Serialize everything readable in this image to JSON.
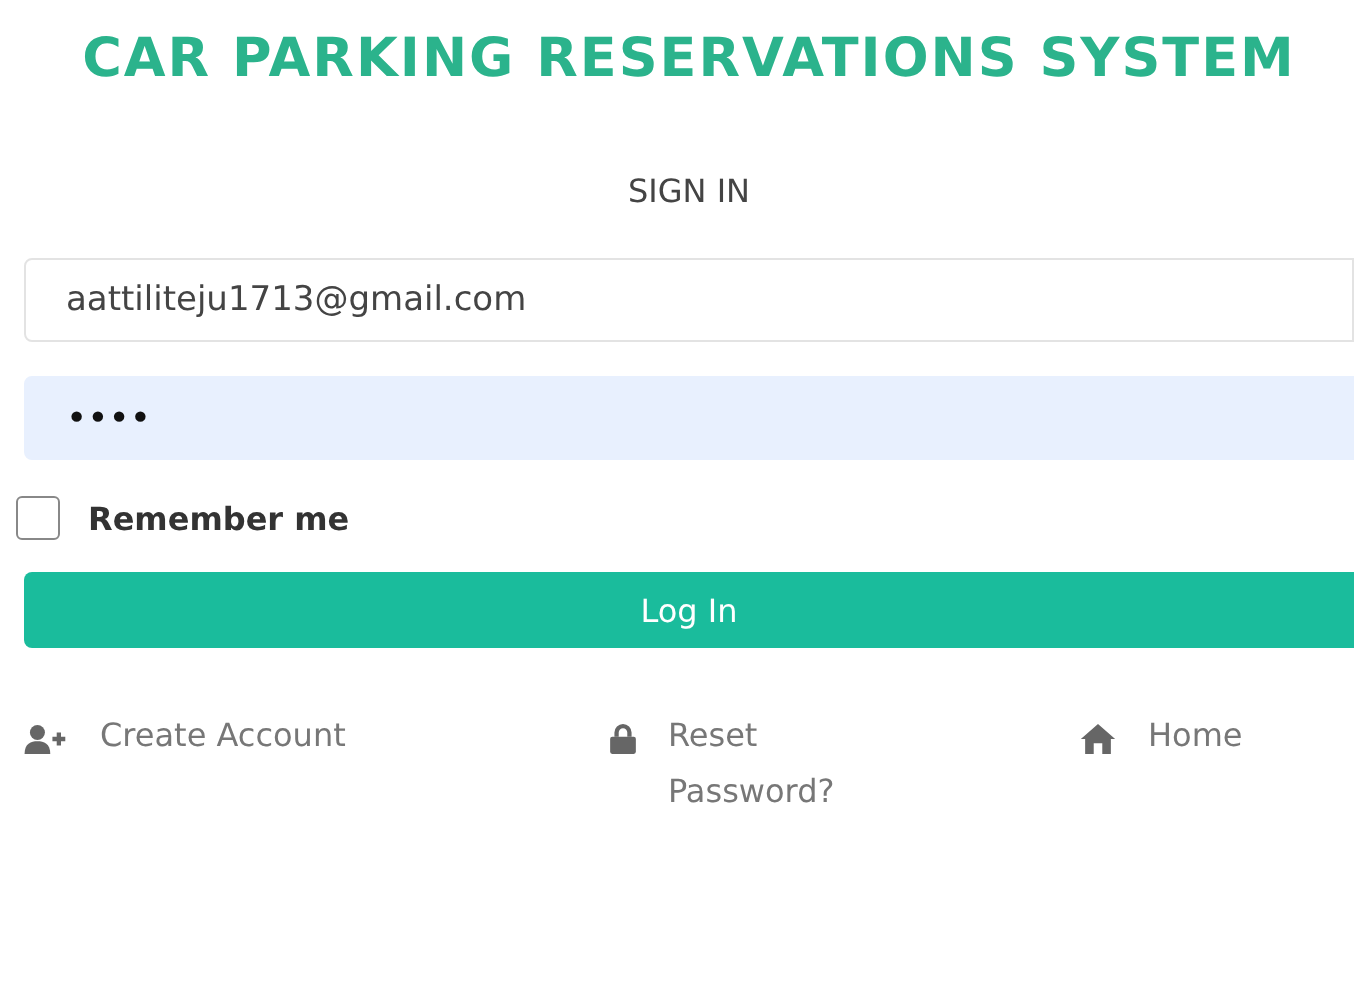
{
  "title": "CAR PARKING RESERVATIONS SYSTEM",
  "heading": "SIGN IN",
  "email_field": {
    "value": "aattiliteju1713@gmail.com"
  },
  "password_field": {
    "value": "••••"
  },
  "remember": {
    "label": "Remember me",
    "checked": false
  },
  "login_button": "Log In",
  "links": [
    {
      "kind": "create",
      "label": "Create Account"
    },
    {
      "kind": "reset",
      "label": "Reset Password?"
    },
    {
      "kind": "home",
      "label": "Home"
    }
  ]
}
